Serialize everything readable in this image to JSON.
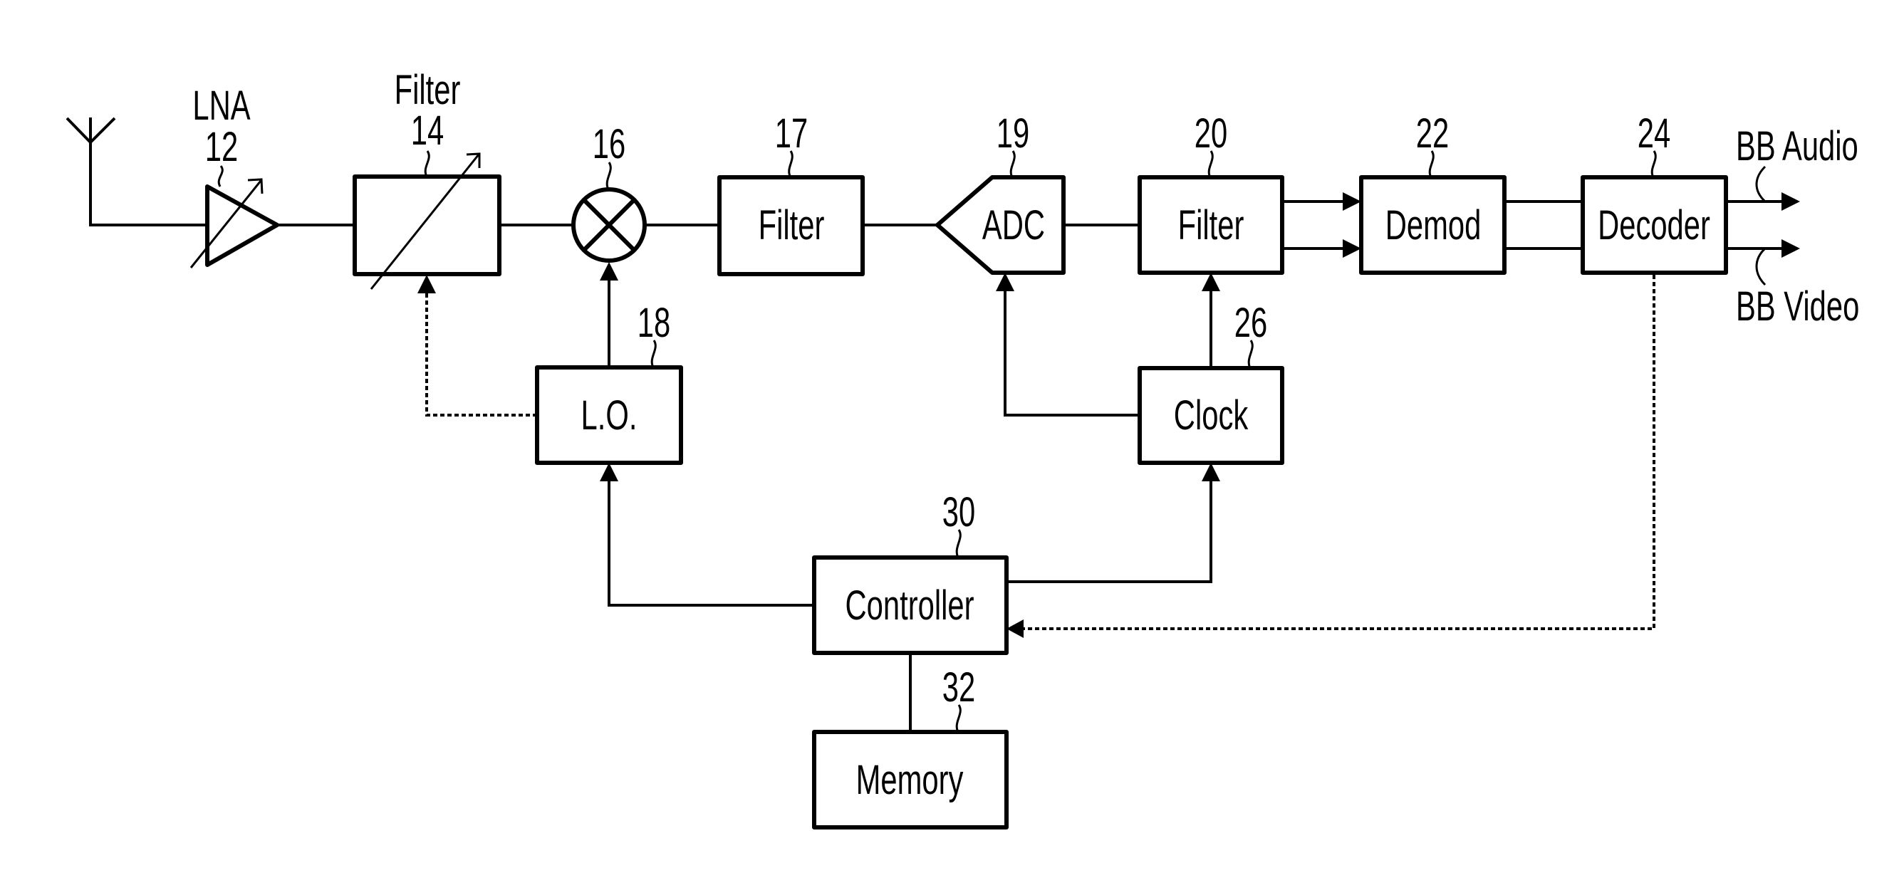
{
  "diagram": {
    "type": "block-diagram",
    "colors": {
      "stroke": "#000000",
      "background": "#ffffff"
    },
    "antenna": {
      "icon": "antenna-icon"
    },
    "blocks": {
      "lna": {
        "name": "LNA",
        "ref": "12",
        "symbol": "variable-gain-amplifier"
      },
      "filter14": {
        "name": "Filter",
        "ref": "14",
        "symbol": "tunable-filter"
      },
      "mixer": {
        "ref": "16",
        "symbol": "mixer"
      },
      "filter17": {
        "label": "Filter",
        "ref": "17"
      },
      "lo": {
        "label": "L.O.",
        "ref": "18"
      },
      "adc": {
        "label": "ADC",
        "ref": "19"
      },
      "filter20": {
        "label": "Filter",
        "ref": "20"
      },
      "demod": {
        "label": "Demod",
        "ref": "22"
      },
      "decoder": {
        "label": "Decoder",
        "ref": "24"
      },
      "clock": {
        "label": "Clock",
        "ref": "26"
      },
      "controller": {
        "label": "Controller",
        "ref": "30"
      },
      "memory": {
        "label": "Memory",
        "ref": "32"
      }
    },
    "outputs": {
      "audio": "BB Audio",
      "video": "BB Video"
    },
    "connections": [
      {
        "from": "antenna",
        "to": "lna",
        "style": "solid"
      },
      {
        "from": "lna",
        "to": "filter14",
        "style": "solid"
      },
      {
        "from": "filter14",
        "to": "mixer",
        "style": "solid"
      },
      {
        "from": "mixer",
        "to": "filter17",
        "style": "solid"
      },
      {
        "from": "filter17",
        "to": "adc",
        "style": "solid"
      },
      {
        "from": "adc",
        "to": "filter20",
        "style": "solid"
      },
      {
        "from": "filter20",
        "to": "demod",
        "style": "solid-arrow",
        "count": 2
      },
      {
        "from": "demod",
        "to": "decoder",
        "style": "solid",
        "count": 2
      },
      {
        "from": "decoder",
        "to": "BB Audio",
        "style": "solid-arrow"
      },
      {
        "from": "decoder",
        "to": "BB Video",
        "style": "solid-arrow"
      },
      {
        "from": "lo",
        "to": "mixer",
        "style": "solid-arrow"
      },
      {
        "from": "lo",
        "to": "filter14",
        "style": "dotted-arrow"
      },
      {
        "from": "clock",
        "to": "adc",
        "style": "solid-arrow"
      },
      {
        "from": "clock",
        "to": "filter20",
        "style": "solid-arrow"
      },
      {
        "from": "controller",
        "to": "lo",
        "style": "solid-arrow"
      },
      {
        "from": "controller",
        "to": "clock",
        "style": "solid-arrow"
      },
      {
        "from": "decoder",
        "to": "controller",
        "style": "dotted-arrow"
      },
      {
        "from": "controller",
        "to": "memory",
        "style": "solid"
      }
    ]
  }
}
